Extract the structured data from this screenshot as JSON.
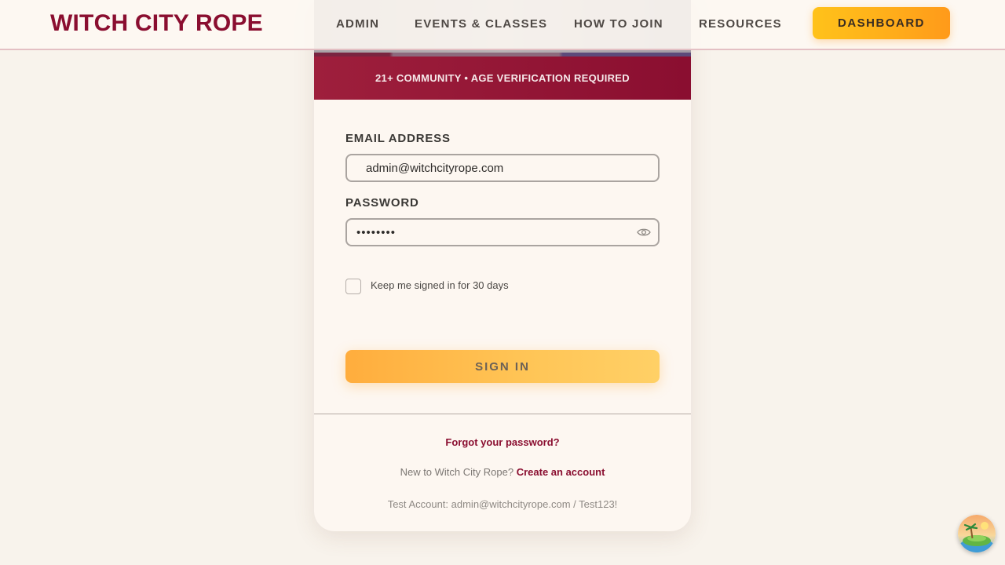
{
  "header": {
    "logo": "WITCH CITY ROPE",
    "nav": [
      "ADMIN",
      "EVENTS & CLASSES",
      "HOW TO JOIN",
      "RESOURCES"
    ],
    "dashboard_label": "DASHBOARD"
  },
  "login": {
    "age_banner": "21+ COMMUNITY • AGE VERIFICATION REQUIRED",
    "email_label": "EMAIL ADDRESS",
    "email_value": "admin@witchcityrope.com",
    "password_label": "PASSWORD",
    "password_value": "••••••••",
    "remember_label": "Keep me signed in for 30 days",
    "signin_label": "SIGN IN",
    "forgot_label": "Forgot your password?",
    "new_prompt": "New to Witch City Rope?",
    "create_label": "Create an account",
    "test_account": "Test Account: admin@witchcityrope.com / Test123!"
  },
  "icons": {
    "password_toggle": "eye-icon",
    "corner_widget": "beach-island-icon"
  },
  "colors": {
    "brand": "#8a0e30",
    "accent": "#ffb530",
    "background": "#f8f3ec"
  }
}
